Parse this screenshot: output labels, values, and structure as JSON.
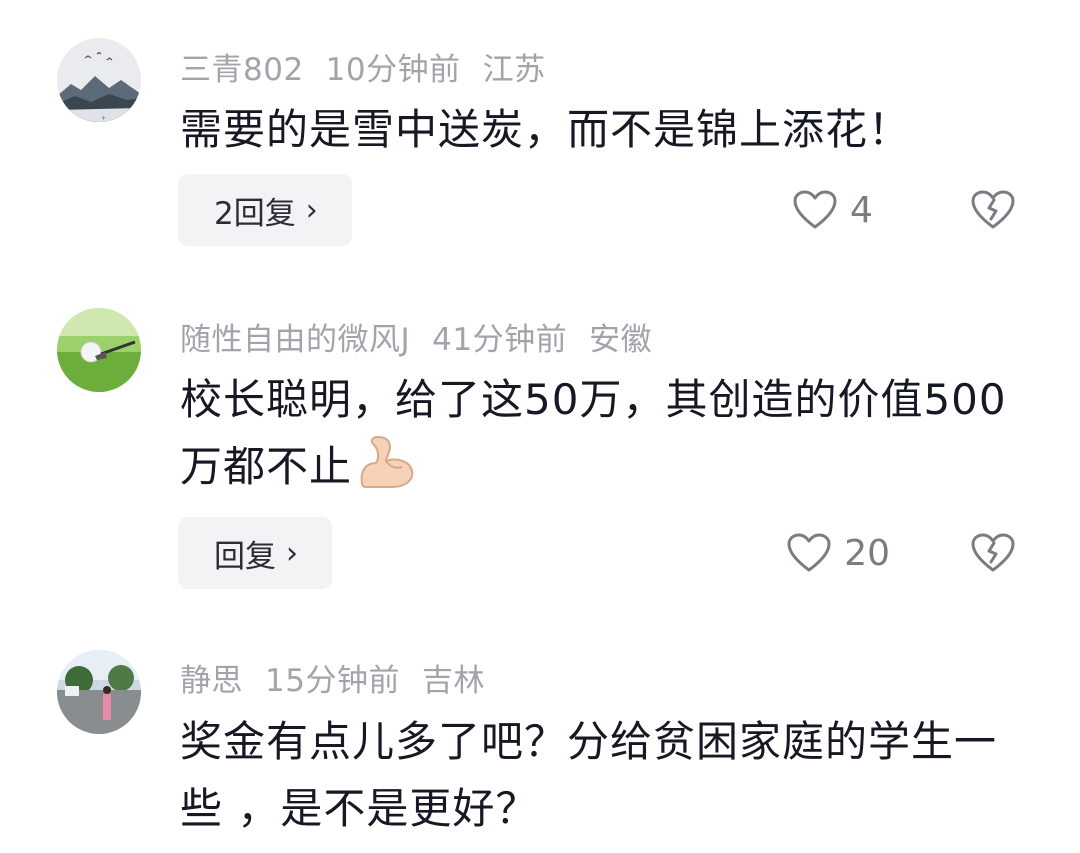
{
  "comments": [
    {
      "username": "三青802",
      "time": "10分钟前",
      "location": "江苏",
      "text": "需要的是雪中送炭，而不是锦上添花！",
      "reply_label": "2回复",
      "likes": "4",
      "avatar_icon": "landscape-mountain-avatar"
    },
    {
      "username": "随性自由的微风J",
      "time": "41分钟前",
      "location": "安徽",
      "text": "校长聪明，给了这50万，其创造的价值500万都不止",
      "emoji": "flexed-biceps-emoji",
      "reply_label": "回复",
      "likes": "20",
      "avatar_icon": "golf-ball-avatar"
    },
    {
      "username": "静思",
      "time": "15分钟前",
      "location": "吉林",
      "text": "奖金有点儿多了吧？分给贫困家庭的学生一些 ，是不是更好？",
      "avatar_icon": "street-photo-avatar"
    }
  ],
  "chevron": "›",
  "colors": {
    "meta": "#a3a3ab",
    "text": "#161823",
    "reply_bg": "#f3f3f5"
  }
}
